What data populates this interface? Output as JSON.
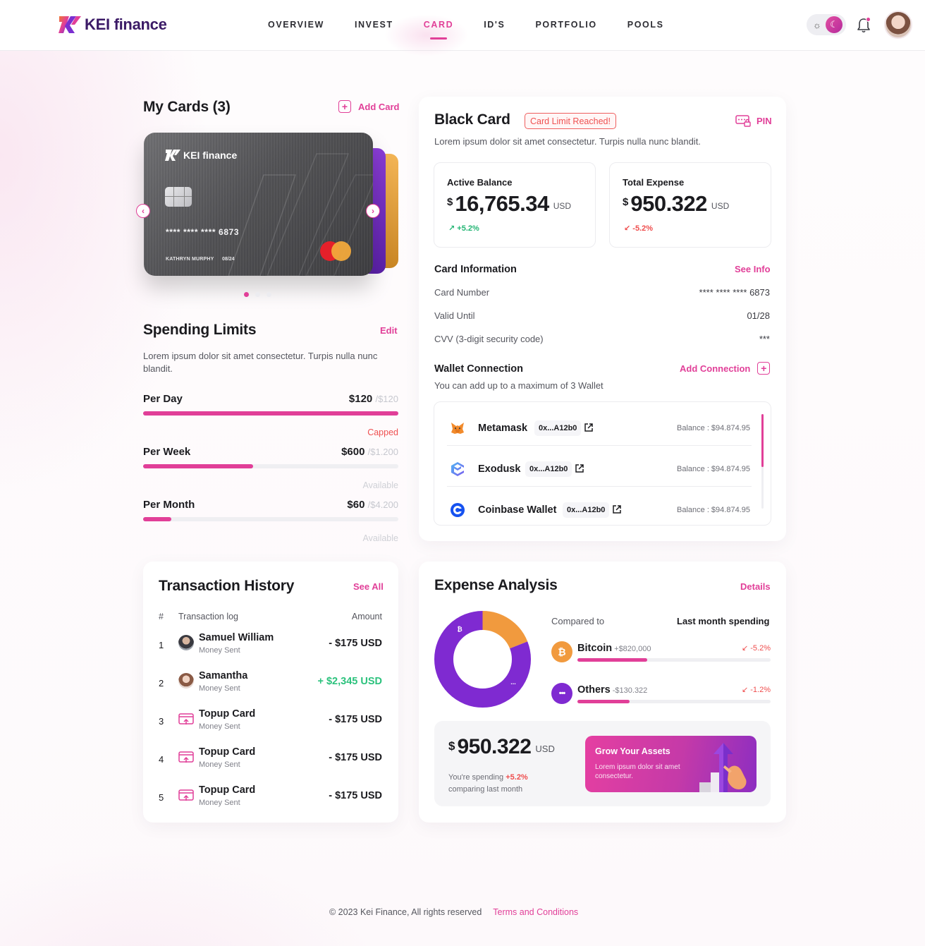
{
  "brand": {
    "name": "KEI finance",
    "card_logo": "KEI finance"
  },
  "nav": {
    "items": [
      {
        "label": "OVERVIEW",
        "active": false
      },
      {
        "label": "INVEST",
        "active": false
      },
      {
        "label": "CARD",
        "active": true
      },
      {
        "label": "ID'S",
        "active": false
      },
      {
        "label": "PORTFOLIO",
        "active": false
      },
      {
        "label": "POOLS",
        "active": false
      }
    ]
  },
  "header_icons": [
    "sun-icon",
    "moon-icon",
    "bell-icon",
    "user-avatar"
  ],
  "colors": {
    "accent": "#e13f98",
    "brand_dark": "#3b1a66",
    "positive": "#22b573",
    "negative": "#ef4d4d",
    "purple": "#7f2ad1",
    "orange": "#f19a3e"
  },
  "my_cards": {
    "title": "My Cards (3)",
    "add_label": "Add Card",
    "card": {
      "number": "**** **** **** 6873",
      "holder": "KATHRYN MURPHY",
      "expiry": "08/24"
    },
    "slide_index": 0,
    "slide_count": 3
  },
  "spending_limits": {
    "title": "Spending Limits",
    "edit_label": "Edit",
    "description": "Lorem ipsum dolor sit amet consectetur. Turpis nulla nunc blandit.",
    "rows": [
      {
        "label": "Per Day",
        "amount": "$120",
        "limit": "/$120",
        "state": "Capped",
        "progress": 1.0
      },
      {
        "label": "Per Week",
        "amount": "$600",
        "limit": "/$1.200",
        "state": "Available",
        "progress": 0.43
      },
      {
        "label": "Per Month",
        "amount": "$60",
        "limit": "/$4.200",
        "state": "Available",
        "progress": 0.11
      }
    ]
  },
  "black_card": {
    "title": "Black Card",
    "badge": "Card Limit Reached!",
    "pin_label": "PIN",
    "description": "Lorem ipsum dolor sit amet consectetur. Turpis nulla nunc blandit.",
    "active_balance": {
      "label": "Active Balance",
      "currency": "$",
      "value": "16,765.34",
      "unit": "USD",
      "change": "+5.2%"
    },
    "total_expense": {
      "label": "Total Expense",
      "currency": "$",
      "value": "950.322",
      "unit": "USD",
      "change": "-5.2%"
    },
    "card_info": {
      "title": "Card Information",
      "see_label": "See Info",
      "rows": [
        {
          "label": "Card Number",
          "value": "**** **** **** 6873"
        },
        {
          "label": "Valid Until",
          "value": "01/28"
        },
        {
          "label": "CVV (3-digit security code)",
          "value": "***"
        }
      ]
    },
    "wallet": {
      "title": "Wallet Connection",
      "add_label": "Add Connection",
      "description": "You can add up to a maximum of 3 Wallet",
      "items": [
        {
          "name": "Metamask",
          "address": "0x...A12b0",
          "balance": "Balance : $94.874.95",
          "icon": "metamask-icon"
        },
        {
          "name": "Exodusk",
          "address": "0x...A12b0",
          "balance": "Balance : $94.874.95",
          "icon": "exodus-icon"
        },
        {
          "name": "Coinbase Wallet",
          "address": "0x...A12b0",
          "balance": "Balance : $94.874.95",
          "icon": "coinbase-icon"
        }
      ]
    }
  },
  "transactions": {
    "title": "Transaction History",
    "see_label": "See All",
    "headers": {
      "index": "#",
      "log": "Transaction log",
      "amount": "Amount"
    },
    "rows": [
      {
        "index": "1",
        "name": "Samuel William",
        "sub": "Money Sent",
        "amount": "- $175 USD",
        "type": "person"
      },
      {
        "index": "2",
        "name": "Samantha",
        "sub": "Money Sent",
        "amount": "+ $2,345 USD",
        "type": "person"
      },
      {
        "index": "3",
        "name": "Topup Card",
        "sub": "Money Sent",
        "amount": "- $175 USD",
        "type": "topup"
      },
      {
        "index": "4",
        "name": "Topup Card",
        "sub": "Money Sent",
        "amount": "- $175 USD",
        "type": "topup"
      },
      {
        "index": "5",
        "name": "Topup Card",
        "sub": "Money Sent",
        "amount": "- $175 USD",
        "type": "topup"
      }
    ]
  },
  "expense": {
    "title": "Expense Analysis",
    "details_label": "Details",
    "compared_label": "Compared to",
    "compared_value": "Last month spending",
    "assets": [
      {
        "name": "Bitcoin",
        "detail": "+$820,000",
        "change": "-5.2%",
        "progress": 0.36,
        "icon_glyph": "₿"
      },
      {
        "name": "Others",
        "detail": "-$130.322",
        "change": "-1.2%",
        "progress": 0.27,
        "icon_glyph": "•••"
      }
    ],
    "donut_labels": {
      "bitcoin": "₿",
      "others": "..."
    },
    "chart_data": {
      "type": "pie",
      "categories": [
        "Bitcoin",
        "Others"
      ],
      "values": [
        0.19,
        0.81
      ],
      "colors": [
        "#f19a3e",
        "#7f2ad1"
      ]
    },
    "total": {
      "currency": "$",
      "value": "950.322",
      "unit": "USD"
    },
    "spending_prefix": "You're spending",
    "spending_pct": "+5.2%",
    "spending_suffix": "comparing last month",
    "grow": {
      "title": "Grow Your Assets",
      "text": "Lorem ipsum dolor sit amet consectetur."
    }
  },
  "footer": {
    "copyright": "© 2023 Kei Finance, All rights reserved",
    "terms": "Terms and Conditions"
  }
}
